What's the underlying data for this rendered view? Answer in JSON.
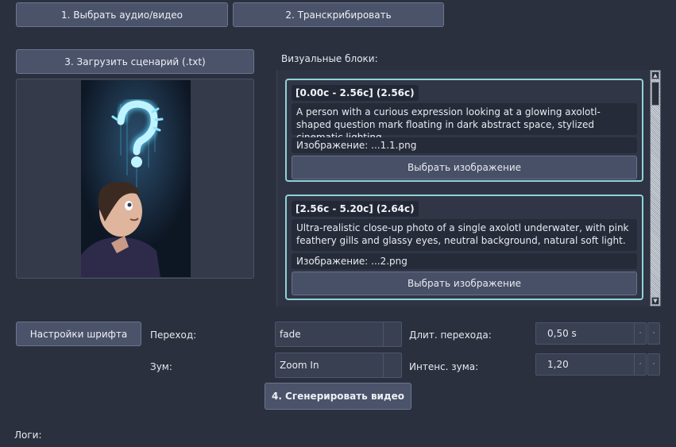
{
  "toolbar": {
    "select_media": "1. Выбрать аудио/видео",
    "transcribe": "2. Транскрибировать",
    "load_script": "3. Загрузить сценарий (.txt)"
  },
  "visual_blocks": {
    "title": "Визуальные блоки:",
    "items": [
      {
        "time": "[0.00c - 2.56c] (2.56c)",
        "description": "A person with a curious expression looking at a glowing axolotl-shaped question mark floating in dark abstract space, stylized cinematic lighting.",
        "image": "Изображение: ...1.1.png",
        "select_button": "Выбрать изображение"
      },
      {
        "time": "[2.56c - 5.20c] (2.64c)",
        "description": "Ultra-realistic close-up photo of a single axolotl underwater, with pink feathery gills and glassy eyes, neutral background, natural soft light.",
        "image": "Изображение: ...2.png",
        "select_button": "Выбрать изображение"
      }
    ]
  },
  "settings": {
    "font_button": "Настройки шрифта",
    "transition_label": "Переход:",
    "transition_value": "fade",
    "zoom_label": "Зум:",
    "zoom_value": "Zoom In",
    "transition_duration_label": "Длит. перехода:",
    "transition_duration_value": "0,50 s",
    "zoom_intensity_label": "Интенс. зума:",
    "zoom_intensity_value": "1,20"
  },
  "generate_button": "4. Сгенерировать видео",
  "logs_label": "Логи:",
  "icons": {
    "scroll_up": "scroll-up-arrow-icon",
    "scroll_down": "scroll-down-arrow-icon",
    "spin_arrow": "spin-arrow-icon",
    "preview_glyph": "question-mark-icon"
  },
  "colors": {
    "background": "#2b303e",
    "button": "#4a5369",
    "block_border": "#8fd3d6",
    "glow": "#5fd6ff"
  }
}
